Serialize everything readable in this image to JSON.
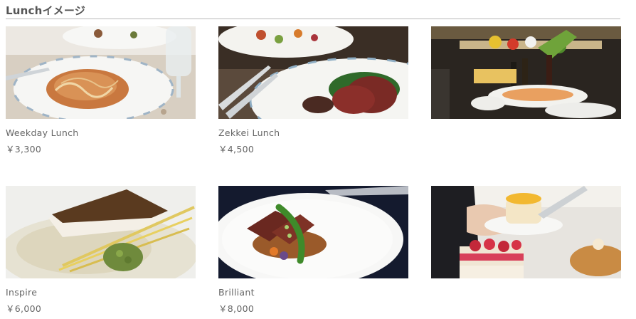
{
  "section": {
    "title": "Lunchイメージ"
  },
  "menu": [
    {
      "name": "Weekday Lunch",
      "price": "￥3,300",
      "photo": "pasta-dish-photo"
    },
    {
      "name": "Zekkei Lunch",
      "price": "￥4,500",
      "photo": "roast-beef-photo"
    },
    {
      "name": "",
      "price": "",
      "photo": "buffet-photo"
    },
    {
      "name": "Inspire",
      "price": "￥6,000",
      "photo": "fish-dish-photo"
    },
    {
      "name": "Brilliant",
      "price": "￥8,000",
      "photo": "beef-dish-photo"
    },
    {
      "name": "",
      "price": "",
      "photo": "dessert-cake-photo"
    }
  ]
}
